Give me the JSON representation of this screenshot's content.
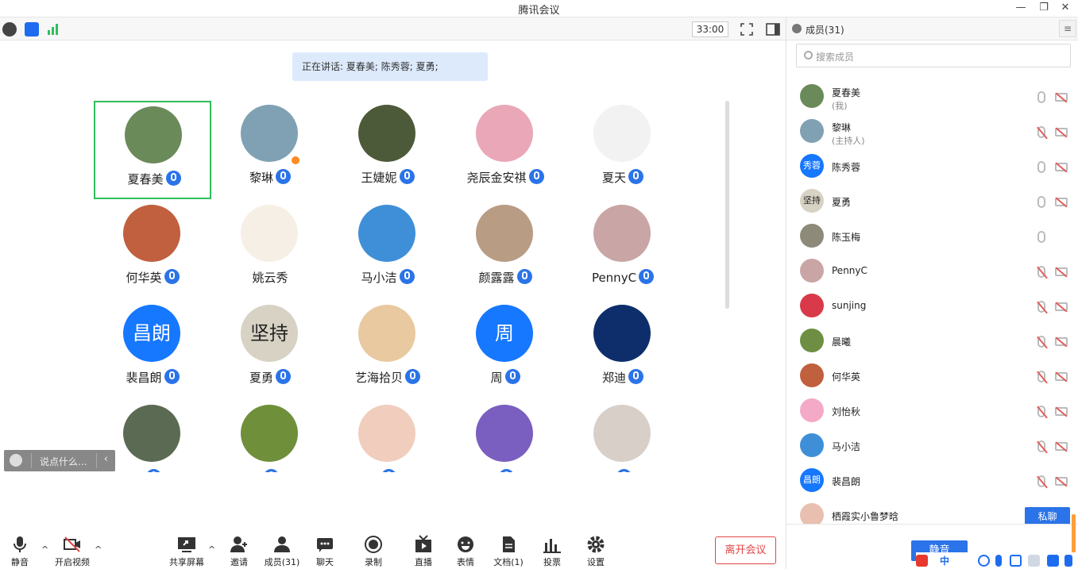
{
  "window": {
    "title": "腾讯会议"
  },
  "topbar": {
    "timer": "33:00"
  },
  "speaking_banner": "正在讲话: 夏春美; 陈秀蓉; 夏勇;",
  "grid": [
    {
      "name": "夏春美",
      "color": "#6b8a5a",
      "selected": true
    },
    {
      "name": "黎琳",
      "color": "#7fa1b3",
      "host": true
    },
    {
      "name": "王婕妮",
      "color": "#4d5a3a"
    },
    {
      "name": "尧辰金安祺",
      "color": "#e9a7b8"
    },
    {
      "name": "夏天",
      "color": "#f2f2f2"
    },
    {
      "name": "何华英",
      "color": "#c0603f"
    },
    {
      "name": "姚云秀",
      "color": "#f6efe6",
      "no_mic": true
    },
    {
      "name": "马小洁",
      "color": "#3f8fd8"
    },
    {
      "name": "颜露露",
      "color": "#b89c84"
    },
    {
      "name": "PennyC",
      "color": "#c9a5a5"
    },
    {
      "name": "裴昌朗",
      "color": "#1677ff",
      "text": "昌朗"
    },
    {
      "name": "夏勇",
      "color": "#d8d2c4",
      "text": "坚持"
    },
    {
      "name": "艺海拾贝",
      "color": "#e9c9a0"
    },
    {
      "name": "周",
      "color": "#1677ff",
      "text": "周"
    },
    {
      "name": "郑迪",
      "color": "#0d2e6b"
    },
    {
      "name": "",
      "color": "#5b6a52"
    },
    {
      "name": "",
      "color": "#6f8f3a"
    },
    {
      "name": "",
      "color": "#f0cdbd"
    },
    {
      "name": "",
      "color": "#7a5fc0"
    },
    {
      "name": "",
      "color": "#d8d0c8"
    }
  ],
  "chat": {
    "placeholder": "说点什么..."
  },
  "bottom": {
    "mute": "静音",
    "video": "开启视频",
    "share": "共享屏幕",
    "invite": "邀请",
    "members": "成员(31)",
    "chat": "聊天",
    "record": "录制",
    "live": "直播",
    "emoji": "表情",
    "docs": "文档(1)",
    "vote": "投票",
    "settings": "设置",
    "leave": "离开会议"
  },
  "panel": {
    "title": "成员(31)",
    "search_placeholder": "搜索成员",
    "members": [
      {
        "name": "夏春美",
        "role": "(我)",
        "color": "#6b8a5a",
        "mic_muted": false
      },
      {
        "name": "黎琳",
        "role": "(主持人)",
        "color": "#7fa1b3",
        "mic_muted": true
      },
      {
        "name": "陈秀蓉",
        "color": "#1677ff",
        "text": "秀蓉",
        "mic_muted": false
      },
      {
        "name": "夏勇",
        "color": "#d8d2c4",
        "text": "坚持",
        "mic_muted": false
      },
      {
        "name": "陈玉梅",
        "color": "#8d8a7a",
        "mic_muted": false,
        "no_cam": true
      },
      {
        "name": "PennyC",
        "color": "#c9a5a5",
        "mic_muted": true
      },
      {
        "name": "sunjing",
        "color": "#d93a4a",
        "mic_muted": true
      },
      {
        "name": "晨曦",
        "color": "#6e8f43",
        "mic_muted": true
      },
      {
        "name": "何华英",
        "color": "#c0603f",
        "mic_muted": true
      },
      {
        "name": "刘怡秋",
        "color": "#f4a9c7",
        "mic_muted": true
      },
      {
        "name": "马小洁",
        "color": "#3f8fd8",
        "mic_muted": true
      },
      {
        "name": "裴昌朗",
        "color": "#1677ff",
        "text": "昌朗",
        "mic_muted": true
      },
      {
        "name": "栖霞实小鲁梦晗",
        "color": "#e9c0b0",
        "mic_muted": true
      }
    ],
    "private_chat": "私聊",
    "mute_all": "静音"
  },
  "ime": {
    "label": "中"
  }
}
